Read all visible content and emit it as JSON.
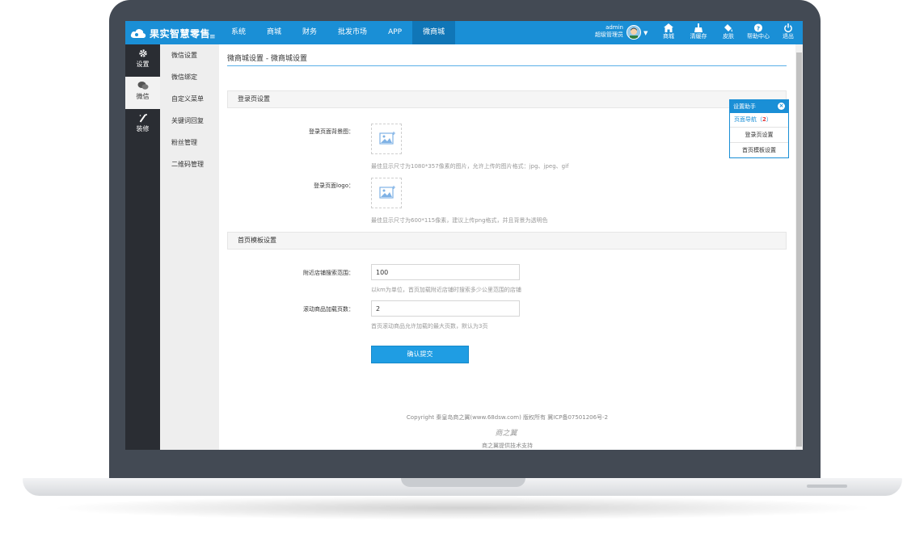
{
  "brand": {
    "name": "果实智慧零售"
  },
  "nav": {
    "items": [
      "系统",
      "商城",
      "财务",
      "批发市场",
      "APP",
      "微商城"
    ],
    "active_index": 5
  },
  "user": {
    "name": "admin",
    "role": "超级管理员"
  },
  "tools": [
    {
      "label": "商城",
      "icon": "home-icon"
    },
    {
      "label": "清缓存",
      "icon": "broom-icon"
    },
    {
      "label": "皮肤",
      "icon": "paint-bucket-icon"
    },
    {
      "label": "帮助中心",
      "icon": "help-icon"
    },
    {
      "label": "退出",
      "icon": "power-icon"
    }
  ],
  "leftbar": [
    {
      "label": "设置",
      "icon": "gear-icon"
    },
    {
      "label": "微信",
      "icon": "wechat-icon"
    },
    {
      "label": "装修",
      "icon": "magic-wand-icon"
    }
  ],
  "subbar": [
    "微信设置",
    "微信绑定",
    "自定义菜单",
    "关键词回复",
    "粉丝管理",
    "二维码管理"
  ],
  "page": {
    "title": "微商城设置 - 微商城设置",
    "section_login": "登录页设置",
    "bg_label": "登录页面背景图：",
    "bg_hint": "最佳显示尺寸为1080*357像素的图片，允许上传的图片格式：jpg、jpeg、gif",
    "logo_label": "登录页面logo：",
    "logo_hint": "最佳显示尺寸为600*115像素，建议上传png格式，并且背景为透明色",
    "section_home": "首页模板设置",
    "range_label": "附近店铺搜索范围：",
    "range_value": "100",
    "range_hint": "以km为单位，首页加载附近店铺时搜索多少公里范围的店铺",
    "pages_label": "滚动商品加载页数：",
    "pages_value": "2",
    "pages_hint": "首页滚动商品允许加载的最大页数，默认为3页",
    "submit": "确认提交"
  },
  "footer": {
    "copyright": "Copyright 秦皇岛商之翼(www.68dsw.com) 版权所有    冀ICP备07501206号-2",
    "logo_text": "商之翼",
    "support": "商之翼提供技术支持"
  },
  "helper": {
    "title": "设置助手",
    "close": "×",
    "nav_label": "页面导航",
    "nav_open": "（",
    "nav_count": "2",
    "nav_close": "）",
    "items": [
      "登录页设置",
      "首页模板设置"
    ]
  },
  "colors": {
    "accent": "#1a8fd6",
    "nav_active": "#1076b7",
    "sidebar_dark": "#2a2d33",
    "button": "#1f9de3",
    "badge": "#e23b3b"
  }
}
